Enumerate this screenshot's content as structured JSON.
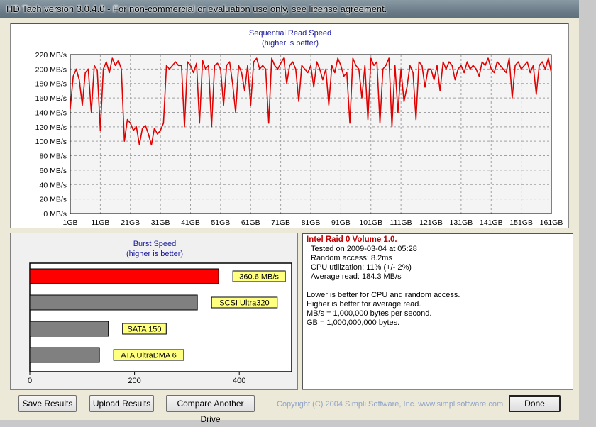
{
  "window": {
    "title": "HD Tach version 3.0.4.0  - For non-commercial or evaluation use only, see license agreement."
  },
  "sequential_chart": {
    "title": "Sequential Read Speed",
    "subtitle": "(higher is better)",
    "line_color": "#e00000",
    "y_ticks": [
      "0 MB/s",
      "20 MB/s",
      "40 MB/s",
      "60 MB/s",
      "80 MB/s",
      "100 MB/s",
      "120 MB/s",
      "140 MB/s",
      "160 MB/s",
      "180 MB/s",
      "200 MB/s",
      "220 MB/s"
    ],
    "x_ticks": [
      "1GB",
      "11GB",
      "21GB",
      "31GB",
      "41GB",
      "51GB",
      "61GB",
      "71GB",
      "81GB",
      "91GB",
      "101GB",
      "111GB",
      "121GB",
      "131GB",
      "141GB",
      "151GB",
      "161GB"
    ]
  },
  "burst_chart": {
    "title": "Burst Speed",
    "subtitle": "(higher is better)",
    "x_ticks": [
      "0",
      "200",
      "400"
    ]
  },
  "info": {
    "drive_name": "Intel Raid 0 Volume 1.0.",
    "tested_on": "Tested on 2009-03-04 at 05:28",
    "random_access": "Random access: 8.2ms",
    "cpu_utilization": "CPU utilization: 11% (+/- 2%)",
    "average_read": "Average read: 184.3 MB/s",
    "notes": [
      "Lower is better for CPU and random access.",
      "Higher is better for average read.",
      "MB/s = 1,000,000 bytes per second.",
      "GB = 1,000,000,000 bytes."
    ]
  },
  "buttons": {
    "save": "Save Results",
    "upload": "Upload Results",
    "compare": "Compare Another Drive",
    "done": "Done"
  },
  "copyright": "Copyright (C) 2004 Simpli Software, Inc. www.simplisoftware.com",
  "chart_data": [
    {
      "type": "line",
      "title": "Sequential Read Speed",
      "subtitle": "(higher is better)",
      "xlabel": "",
      "ylabel": "",
      "x_unit": "GB",
      "y_unit": "MB/s",
      "xlim": [
        1,
        161
      ],
      "ylim": [
        0,
        220
      ],
      "grid": true,
      "series": [
        {
          "color": "#e00000",
          "x": [
            1,
            2,
            3,
            4,
            5,
            6,
            7,
            8,
            9,
            10,
            11,
            12,
            13,
            14,
            15,
            16,
            17,
            18,
            19,
            20,
            21,
            22,
            23,
            24,
            25,
            26,
            27,
            28,
            29,
            30,
            31,
            32,
            33,
            34,
            35,
            36,
            37,
            38,
            39,
            40,
            41,
            42,
            43,
            44,
            45,
            46,
            47,
            48,
            49,
            50,
            51,
            52,
            53,
            54,
            55,
            56,
            57,
            58,
            59,
            60,
            61,
            62,
            63,
            64,
            65,
            66,
            67,
            68,
            69,
            70,
            71,
            72,
            73,
            74,
            75,
            76,
            77,
            78,
            79,
            80,
            81,
            82,
            83,
            84,
            85,
            86,
            87,
            88,
            89,
            90,
            91,
            92,
            93,
            94,
            95,
            96,
            97,
            98,
            99,
            100,
            101,
            102,
            103,
            104,
            105,
            106,
            107,
            108,
            109,
            110,
            111,
            112,
            113,
            114,
            115,
            116,
            117,
            118,
            119,
            120,
            121,
            122,
            123,
            124,
            125,
            126,
            127,
            128,
            129,
            130,
            131,
            132,
            133,
            134,
            135,
            136,
            137,
            138,
            139,
            140,
            141,
            142,
            143,
            144,
            145,
            146,
            147,
            148,
            149,
            150,
            151,
            152,
            153,
            154,
            155,
            156,
            157,
            158,
            159,
            160,
            161
          ],
          "y": [
            145,
            190,
            200,
            185,
            150,
            195,
            200,
            140,
            205,
            198,
            115,
            200,
            210,
            195,
            215,
            205,
            212,
            200,
            100,
            130,
            125,
            115,
            120,
            95,
            118,
            122,
            110,
            95,
            118,
            110,
            115,
            125,
            205,
            200,
            205,
            210,
            205,
            205,
            120,
            210,
            205,
            195,
            208,
            125,
            212,
            200,
            205,
            120,
            205,
            208,
            200,
            150,
            205,
            210,
            180,
            140,
            205,
            195,
            170,
            205,
            150,
            210,
            215,
            200,
            205,
            200,
            125,
            215,
            205,
            200,
            208,
            215,
            180,
            205,
            210,
            200,
            155,
            205,
            200,
            195,
            205,
            175,
            210,
            200,
            185,
            200,
            150,
            205,
            195,
            215,
            205,
            190,
            195,
            125,
            215,
            205,
            200,
            160,
            205,
            130,
            215,
            205,
            210,
            125,
            200,
            205,
            215,
            120,
            205,
            140,
            200,
            155,
            175,
            205,
            195,
            130,
            210,
            205,
            175,
            200,
            200,
            185,
            205,
            170,
            210,
            200,
            210,
            205,
            185,
            200,
            205,
            195,
            210,
            200,
            205,
            200,
            190,
            210,
            205,
            215,
            200,
            195,
            210,
            205,
            200,
            195,
            215,
            160,
            205,
            210,
            200,
            205,
            210,
            195,
            205,
            165,
            205,
            210,
            200,
            215,
            195
          ]
        }
      ]
    },
    {
      "type": "bar",
      "title": "Burst Speed",
      "subtitle": "(higher is better)",
      "orientation": "horizontal",
      "xlim": [
        0,
        500
      ],
      "categories": [
        "360.6 MB/s",
        "SCSI Ultra320",
        "SATA 150",
        "ATA UltraDMA 6"
      ],
      "values": [
        360.6,
        320,
        150,
        133
      ],
      "colors": [
        "#ff0000",
        "#808080",
        "#808080",
        "#808080"
      ]
    }
  ]
}
